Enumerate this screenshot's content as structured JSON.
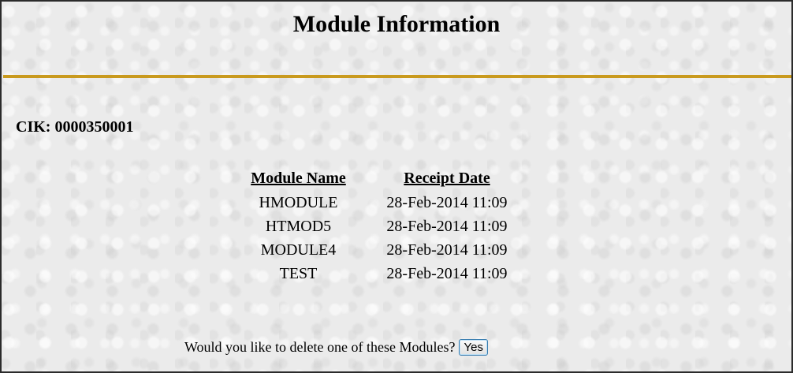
{
  "page": {
    "title": "Module Information",
    "rule_color": "#c99a1e",
    "cik_label": "CIK: 0000350001"
  },
  "table": {
    "headers": {
      "module_name": "Module Name",
      "receipt_date": "Receipt Date"
    },
    "rows": [
      {
        "name": "HMODULE",
        "date": "28-Feb-2014 11:09"
      },
      {
        "name": "HTMOD5",
        "date": "28-Feb-2014 11:09"
      },
      {
        "name": "MODULE4",
        "date": "28-Feb-2014 11:09"
      },
      {
        "name": "TEST",
        "date": "28-Feb-2014 11:09"
      }
    ]
  },
  "prompt": {
    "question": "Would you like to delete one of these Modules?",
    "yes_label": "Yes"
  }
}
